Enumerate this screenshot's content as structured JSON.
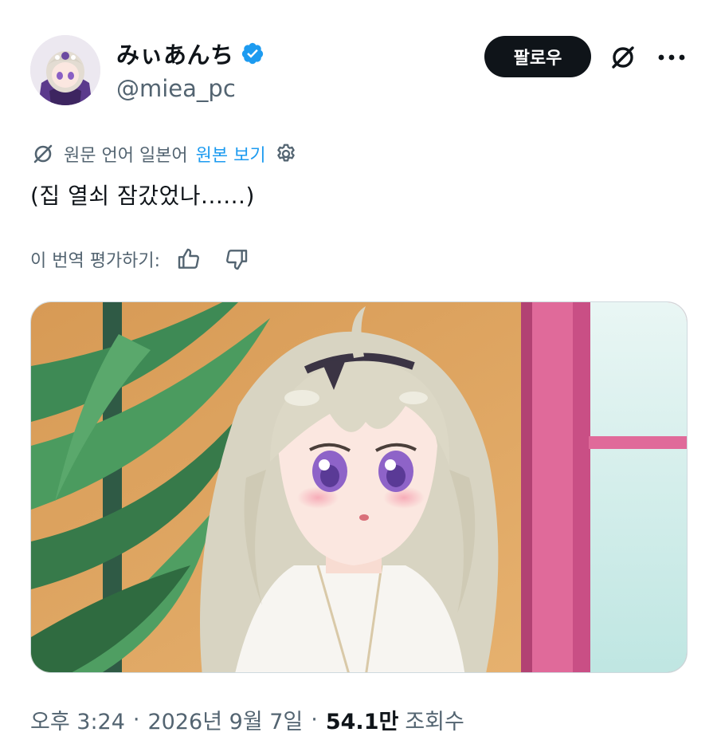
{
  "author": {
    "display_name": "みぃあんち",
    "handle": "@miea_pc",
    "verified": true,
    "avatar_icon": "avatar-image"
  },
  "actions": {
    "follow_label": "팔로우",
    "grok_icon": "grok-icon",
    "more_icon": "more-icon"
  },
  "translation": {
    "info": "원문 언어 일본어",
    "show_original": "원본 보기",
    "settings_icon": "gear-icon"
  },
  "tweet": {
    "text": "(집 열쇠 잠갔었나......)"
  },
  "rating": {
    "label": "이 번역 평가하기:",
    "thumbs_up_icon": "thumbs-up-icon",
    "thumbs_down_icon": "thumbs-down-icon"
  },
  "meta": {
    "time": "오후 3:24",
    "separator": "·",
    "date": "2026년 9월 7일",
    "views_count": "54.1만",
    "views_label": "조회수"
  },
  "colors": {
    "text_primary": "#0f1419",
    "text_secondary": "#536471",
    "accent": "#1d9bf0",
    "verified_badge": "#1d9bf0"
  }
}
